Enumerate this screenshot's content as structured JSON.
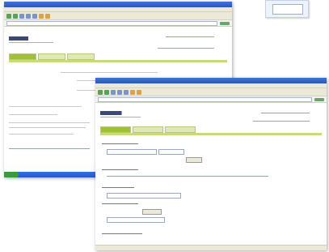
{
  "window_back": {
    "site_logo": "",
    "tabs": [
      "",
      "",
      ""
    ],
    "accent_color": "#9fc13a"
  },
  "window_front": {
    "site_logo": "",
    "tabs": [
      "",
      "",
      ""
    ],
    "button_label": "",
    "accent_color": "#9fc13a"
  },
  "colors": {
    "xp_titlebar": "#2a59b8",
    "tab_active": "#9fc13a",
    "tab_inactive": "#dfe8b7",
    "alert_text": "#c0392b"
  },
  "icons": [
    "back-icon",
    "forward-icon",
    "stop-icon",
    "refresh-icon",
    "home-icon",
    "search-icon",
    "favorites-icon",
    "go-icon"
  ]
}
